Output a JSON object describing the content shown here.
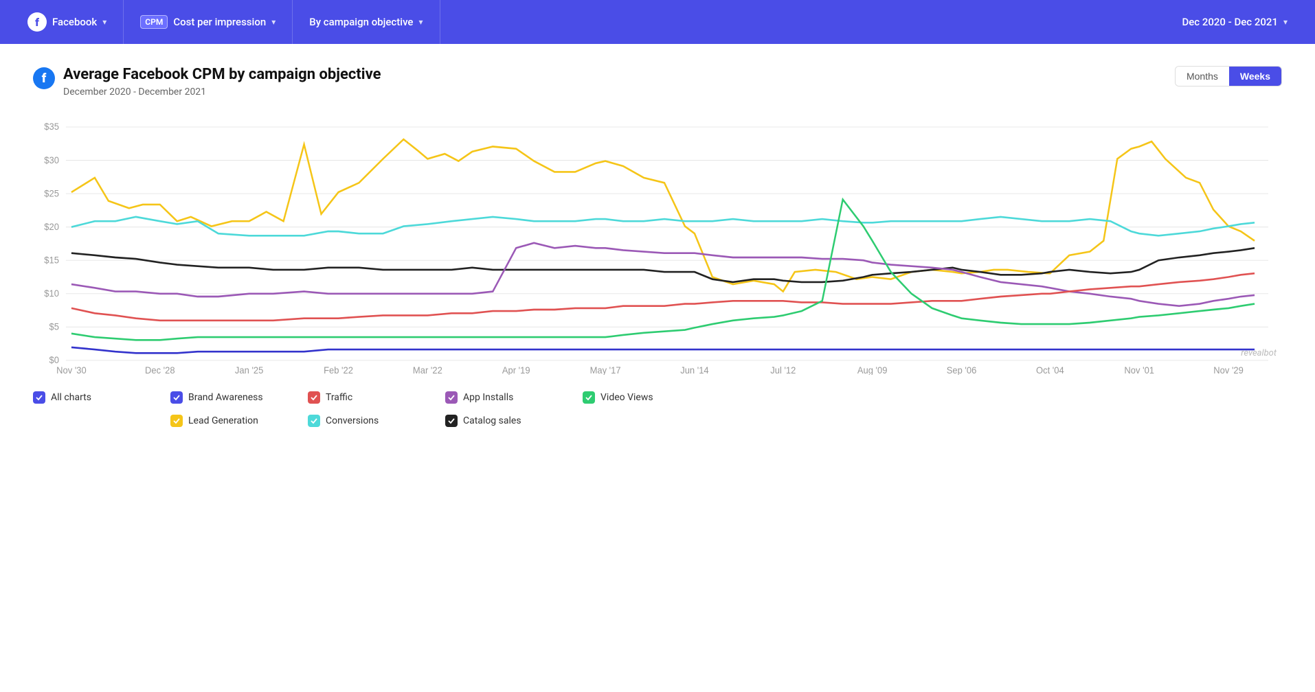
{
  "header": {
    "facebook_label": "Facebook",
    "cpm_badge": "CPM",
    "metric_label": "Cost per impression",
    "breakdown_label": "By campaign objective",
    "date_range_label": "Dec 2020 - Dec 2021",
    "chevron": "▾"
  },
  "chart": {
    "title": "Average Facebook CPM by campaign objective",
    "subtitle": "December 2020 - December 2021",
    "toggle_months": "Months",
    "toggle_weeks": "Weeks",
    "active_toggle": "weeks",
    "watermark": "revealbot",
    "y_labels": [
      "$35",
      "$30",
      "$25",
      "$20",
      "$15",
      "$10",
      "$5",
      "$0"
    ],
    "x_labels": [
      "Nov '30",
      "Dec '28",
      "Jan '25",
      "Feb '22",
      "Mar '22",
      "Apr '19",
      "May '17",
      "Jun '14",
      "Jul '12",
      "Aug '09",
      "Sep '06",
      "Oct '04",
      "Nov '01",
      "Nov '29"
    ]
  },
  "legend": {
    "items": [
      {
        "label": "All charts",
        "color": "#4a4de7",
        "type": "filled"
      },
      {
        "label": "Brand Awareness",
        "color": "#4a4de7",
        "type": "filled"
      },
      {
        "label": "Lead Generation",
        "color": "#f5c518",
        "type": "filled"
      },
      {
        "label": "Traffic",
        "color": "#e05252",
        "type": "filled"
      },
      {
        "label": "Conversions",
        "color": "#4dd9d9",
        "type": "filled"
      },
      {
        "label": "App Installs",
        "color": "#9b59b6",
        "type": "filled"
      },
      {
        "label": "Catalog sales",
        "color": "#222",
        "type": "filled"
      },
      {
        "label": "Video Views",
        "color": "#2ecc71",
        "type": "filled"
      }
    ]
  }
}
